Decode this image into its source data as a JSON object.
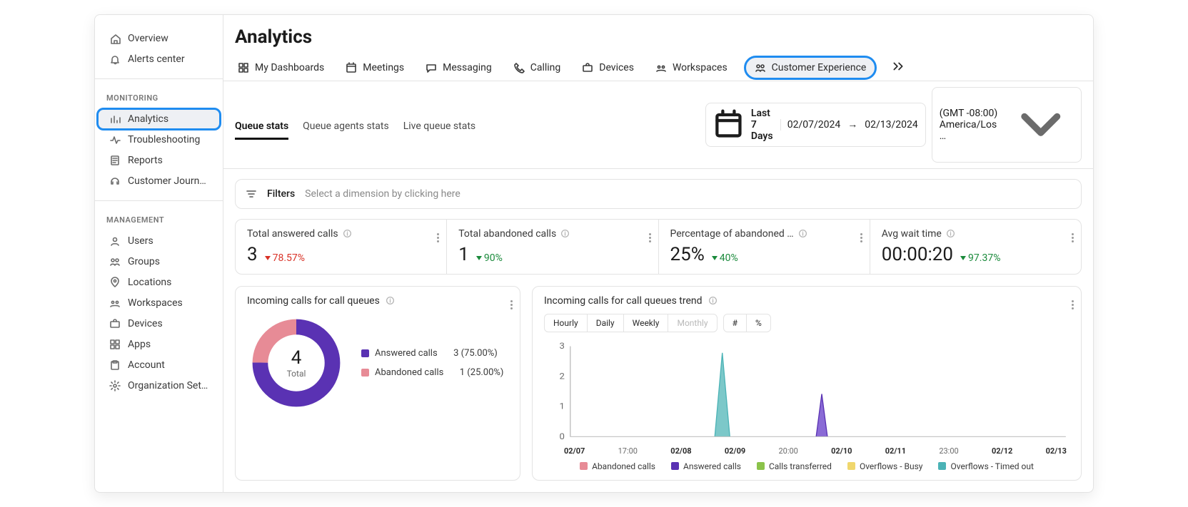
{
  "sidebar": {
    "top_items": [
      {
        "icon": "home",
        "label": "Overview"
      },
      {
        "icon": "bell",
        "label": "Alerts center"
      }
    ],
    "monitoring_title": "MONITORING",
    "monitoring_items": [
      {
        "icon": "bars",
        "label": "Analytics",
        "active": true
      },
      {
        "icon": "pulse",
        "label": "Troubleshooting"
      },
      {
        "icon": "doc",
        "label": "Reports"
      },
      {
        "icon": "headset",
        "label": "Customer Journey Data"
      }
    ],
    "management_title": "MANAGEMENT",
    "management_items": [
      {
        "icon": "user",
        "label": "Users"
      },
      {
        "icon": "groups",
        "label": "Groups"
      },
      {
        "icon": "pin",
        "label": "Locations"
      },
      {
        "icon": "workspace",
        "label": "Workspaces"
      },
      {
        "icon": "briefcase",
        "label": "Devices"
      },
      {
        "icon": "grid",
        "label": "Apps"
      },
      {
        "icon": "clipboard",
        "label": "Account"
      },
      {
        "icon": "gear",
        "label": "Organization Settings"
      }
    ]
  },
  "header": {
    "title": "Analytics"
  },
  "tabs": [
    {
      "icon": "grid",
      "label": "My Dashboards"
    },
    {
      "icon": "calendar",
      "label": "Meetings"
    },
    {
      "icon": "chat",
      "label": "Messaging"
    },
    {
      "icon": "phone",
      "label": "Calling"
    },
    {
      "icon": "briefcase",
      "label": "Devices"
    },
    {
      "icon": "workspace",
      "label": "Workspaces"
    },
    {
      "icon": "groups",
      "label": "Customer Experience",
      "highlighted": true
    }
  ],
  "subtabs": {
    "items": [
      "Queue stats",
      "Queue agents stats",
      "Live queue stats"
    ],
    "active": 0,
    "range_label": "Last 7 Days",
    "date_from": "02/07/2024",
    "date_arrow": "→",
    "date_to": "02/13/2024",
    "tz": "(GMT -08:00) America/Los …"
  },
  "filters": {
    "title": "Filters",
    "placeholder": "Select a dimension by clicking here"
  },
  "kpis": [
    {
      "title": "Total answered calls",
      "value": "3",
      "delta": "78.57%",
      "dir": "down",
      "color": "red"
    },
    {
      "title": "Total abandoned calls",
      "value": "1",
      "delta": "90%",
      "dir": "down",
      "color": "green"
    },
    {
      "title": "Percentage of abandoned …",
      "value": "25%",
      "delta": "40%",
      "dir": "down",
      "color": "green"
    },
    {
      "title": "Avg wait time",
      "value": "00:00:20",
      "delta": "97.37%",
      "dir": "down",
      "color": "green"
    }
  ],
  "donut_card": {
    "title": "Incoming calls for call queues",
    "total_value": "4",
    "total_label": "Total",
    "legend": [
      {
        "color": "#5a32b3",
        "label": "Answered calls",
        "count": "3",
        "pct": "(75.00%)"
      },
      {
        "color": "#e78b96",
        "label": "Abandoned calls",
        "count": "1",
        "pct": "(25.00%)"
      }
    ]
  },
  "trend_card": {
    "title": "Incoming calls for call queues trend",
    "seg_time": [
      "Hourly",
      "Daily",
      "Weekly",
      "Monthly"
    ],
    "seg_val": [
      "#",
      "%"
    ],
    "seg_time_dim_index": 3,
    "yticks": [
      "3",
      "2",
      "1",
      "0"
    ],
    "xlabels": [
      "02/07",
      "17:00",
      "02/08",
      "02/09",
      "20:00",
      "02/10",
      "02/11",
      "23:00",
      "02/12",
      "02/13"
    ],
    "xbold": [
      true,
      false,
      true,
      true,
      false,
      true,
      true,
      false,
      true,
      true
    ],
    "legend": [
      {
        "color": "#e78b96",
        "label": "Abandoned calls"
      },
      {
        "color": "#5a32b3",
        "label": "Answered calls"
      },
      {
        "color": "#8bc34a",
        "label": "Calls transferred"
      },
      {
        "color": "#f0d76d",
        "label": "Overflows - Busy"
      },
      {
        "color": "#4bb3b6",
        "label": "Overflows - Timed out"
      }
    ]
  },
  "chart_data": [
    {
      "type": "pie",
      "title": "Incoming calls for call queues",
      "categories": [
        "Answered calls",
        "Abandoned calls"
      ],
      "values": [
        3,
        1
      ],
      "colors": [
        "#5a32b3",
        "#e78b96"
      ]
    },
    {
      "type": "line",
      "title": "Incoming calls for call queues trend",
      "x": [
        "02/07",
        "17:00",
        "02/08",
        "02/09",
        "20:00",
        "02/10",
        "02/11",
        "23:00",
        "02/12",
        "02/13"
      ],
      "series": [
        {
          "name": "Abandoned calls",
          "color": "#e78b96",
          "values": [
            0,
            0,
            0,
            0,
            0,
            0,
            0,
            0,
            0,
            0
          ]
        },
        {
          "name": "Answered calls",
          "color": "#5a32b3",
          "values": [
            0,
            0,
            0,
            2,
            0,
            1,
            0,
            0,
            0,
            0
          ]
        },
        {
          "name": "Calls transferred",
          "color": "#8bc34a",
          "values": [
            0,
            0,
            0,
            0,
            0,
            0,
            0,
            0,
            0,
            0
          ]
        },
        {
          "name": "Overflows - Busy",
          "color": "#f0d76d",
          "values": [
            0,
            0,
            0,
            0,
            0,
            0,
            0,
            0,
            0,
            0
          ]
        },
        {
          "name": "Overflows - Timed out",
          "color": "#4bb3b6",
          "values": [
            0,
            0,
            0,
            2,
            0,
            1,
            0,
            0,
            0,
            0
          ]
        }
      ],
      "ylim": [
        0,
        3
      ],
      "xlabel": "",
      "ylabel": ""
    }
  ]
}
